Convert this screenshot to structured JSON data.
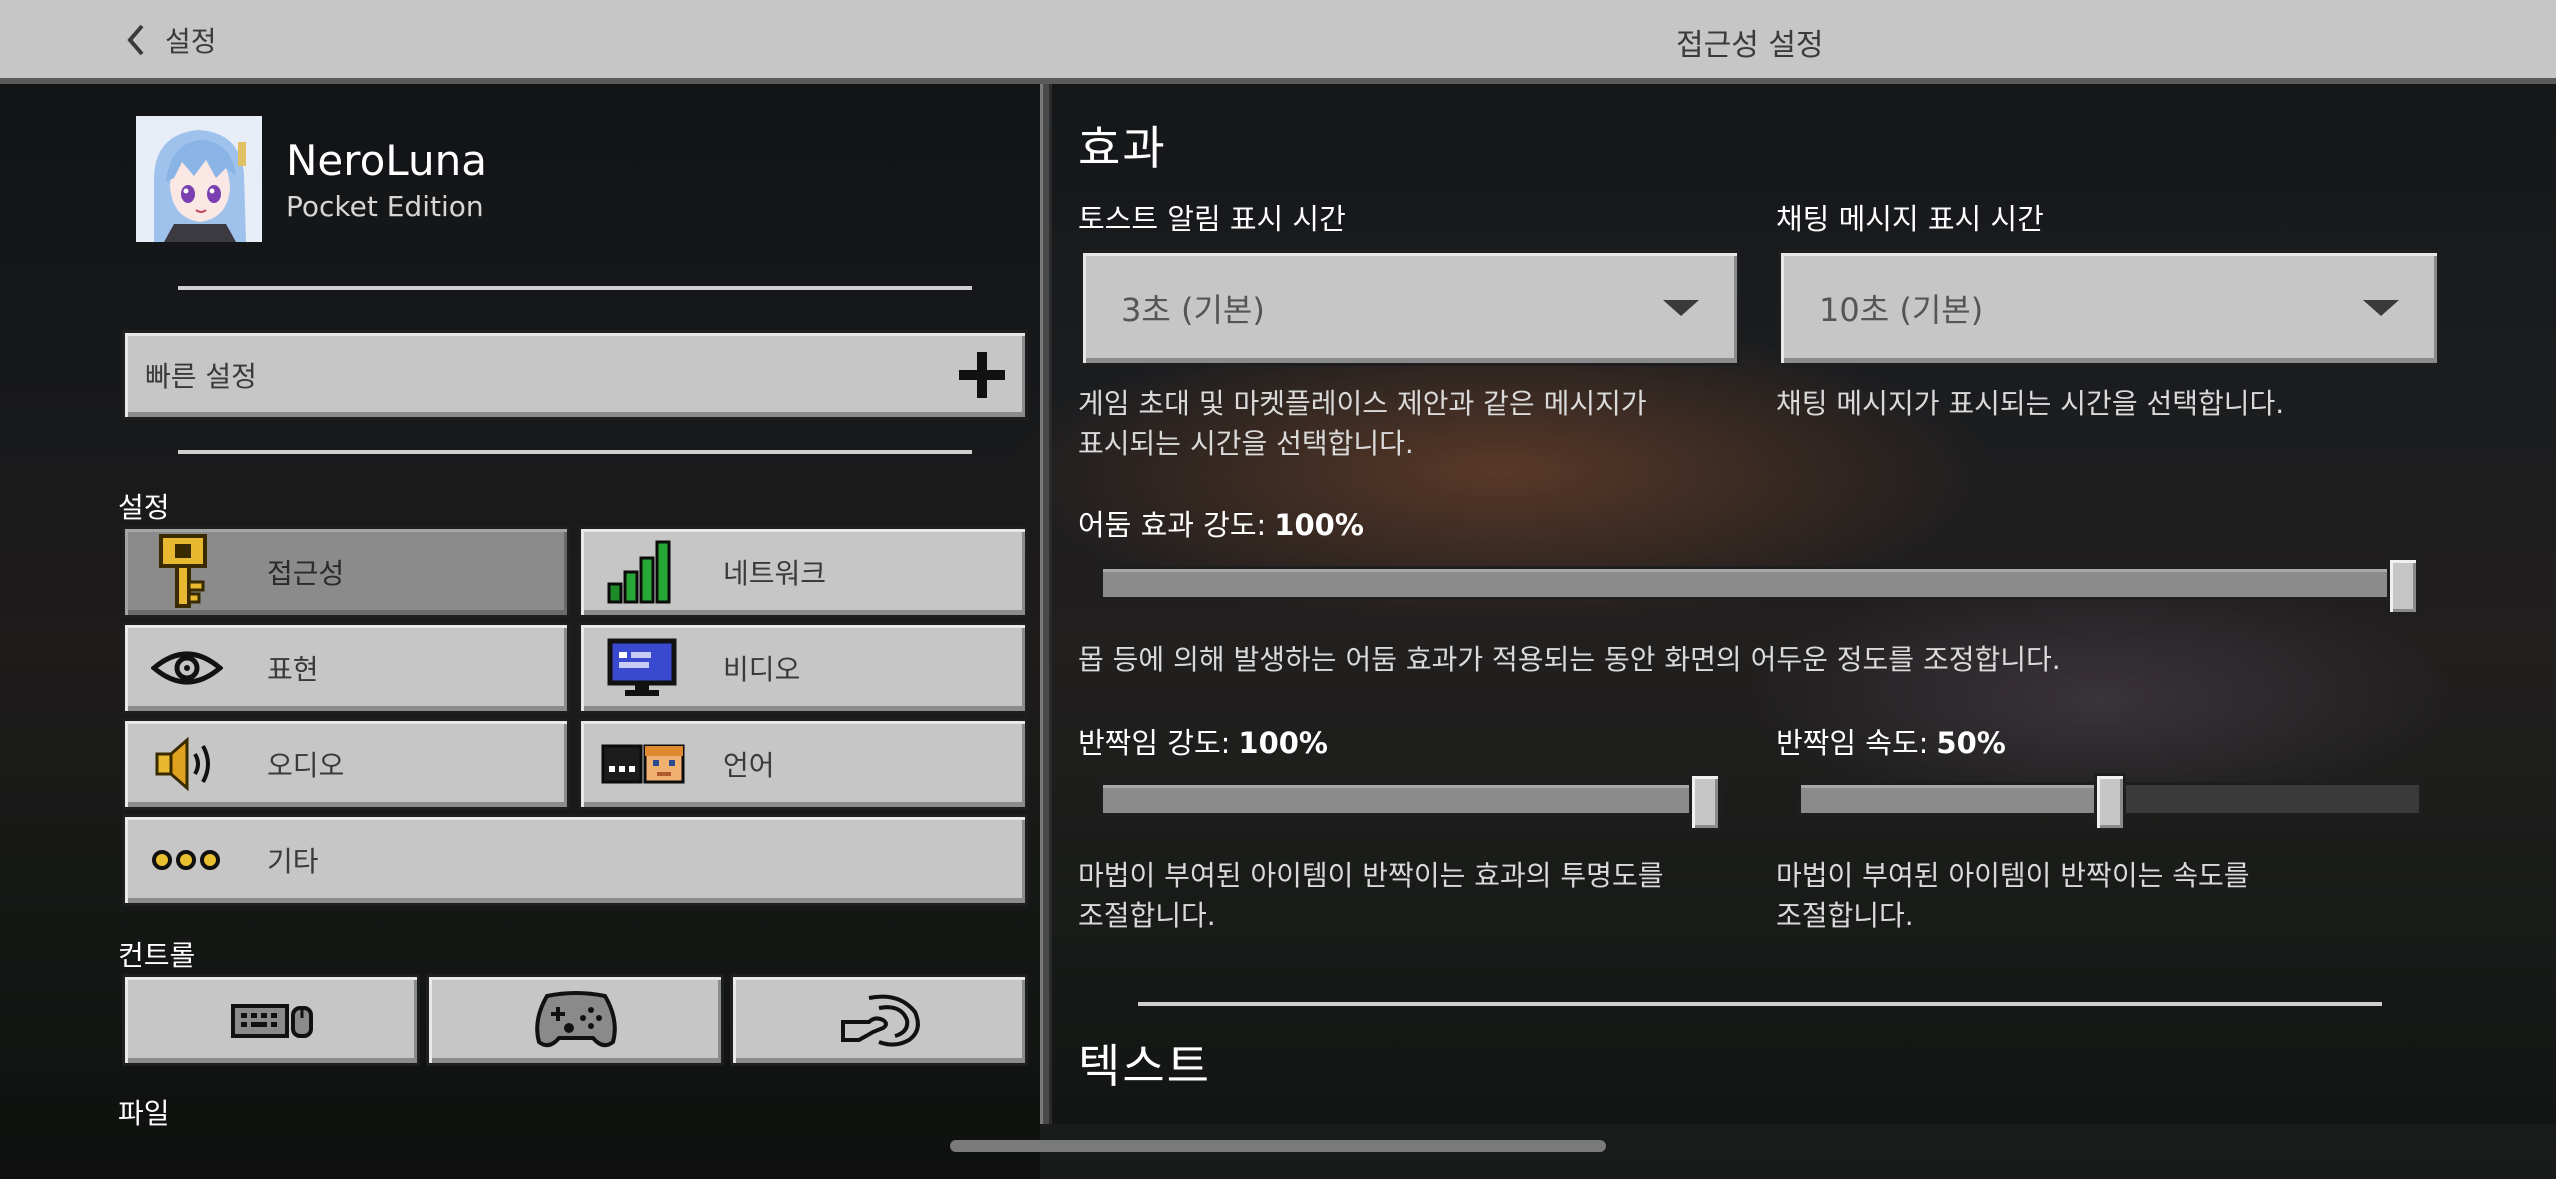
{
  "header": {
    "back_label": "설정",
    "title": "접근성 설정"
  },
  "profile": {
    "name": "NeroLuna",
    "edition": "Pocket Edition"
  },
  "quick_settings": {
    "label": "빠른 설정"
  },
  "settings_section": {
    "label": "설정",
    "items": [
      {
        "label": "접근성",
        "icon": "key-icon",
        "selected": true
      },
      {
        "label": "네트워크",
        "icon": "network-signal-icon",
        "selected": false
      },
      {
        "label": "표현",
        "icon": "eye-icon",
        "selected": false
      },
      {
        "label": "비디오",
        "icon": "monitor-icon",
        "selected": false
      },
      {
        "label": "오디오",
        "icon": "speaker-icon",
        "selected": false
      },
      {
        "label": "언어",
        "icon": "language-icon",
        "selected": false
      },
      {
        "label": "기타",
        "icon": "more-dots-icon",
        "selected": false
      }
    ]
  },
  "controls_section": {
    "label": "컨트롤",
    "items": [
      {
        "icon": "keyboard-mouse-icon"
      },
      {
        "icon": "gamepad-icon"
      },
      {
        "icon": "touch-icon"
      }
    ]
  },
  "file_section": {
    "label": "파일"
  },
  "effects": {
    "heading": "효과",
    "toast": {
      "label": "토스트 알림 표시 시간",
      "value": "3초 (기본)",
      "description": "게임 초대 및 마켓플레이스 제안과 같은 메시지가\n표시되는 시간을 선택합니다."
    },
    "chat": {
      "label": "채팅 메시지 표시 시간",
      "value": "10초 (기본)",
      "description": "채팅 메시지가 표시되는 시간을 선택합니다."
    },
    "darkness": {
      "label": "어둠 효과 강도:",
      "value_text": "100%",
      "value": 100,
      "description": "몹 등에 의해 발생하는 어둠 효과가 적용되는 동안 화면의 어두운 정도를 조정합니다."
    },
    "glint_strength": {
      "label": "반짝임 강도:",
      "value_text": "100%",
      "value": 100,
      "description": "마법이 부여된 아이템이 반짝이는 효과의 투명도를\n조절합니다."
    },
    "glint_speed": {
      "label": "반짝임 속도:",
      "value_text": "50%",
      "value": 50,
      "description": "마법이 부여된 아이템이 반짝이는 속도를\n조절합니다."
    }
  },
  "text_section": {
    "heading": "텍스트"
  }
}
